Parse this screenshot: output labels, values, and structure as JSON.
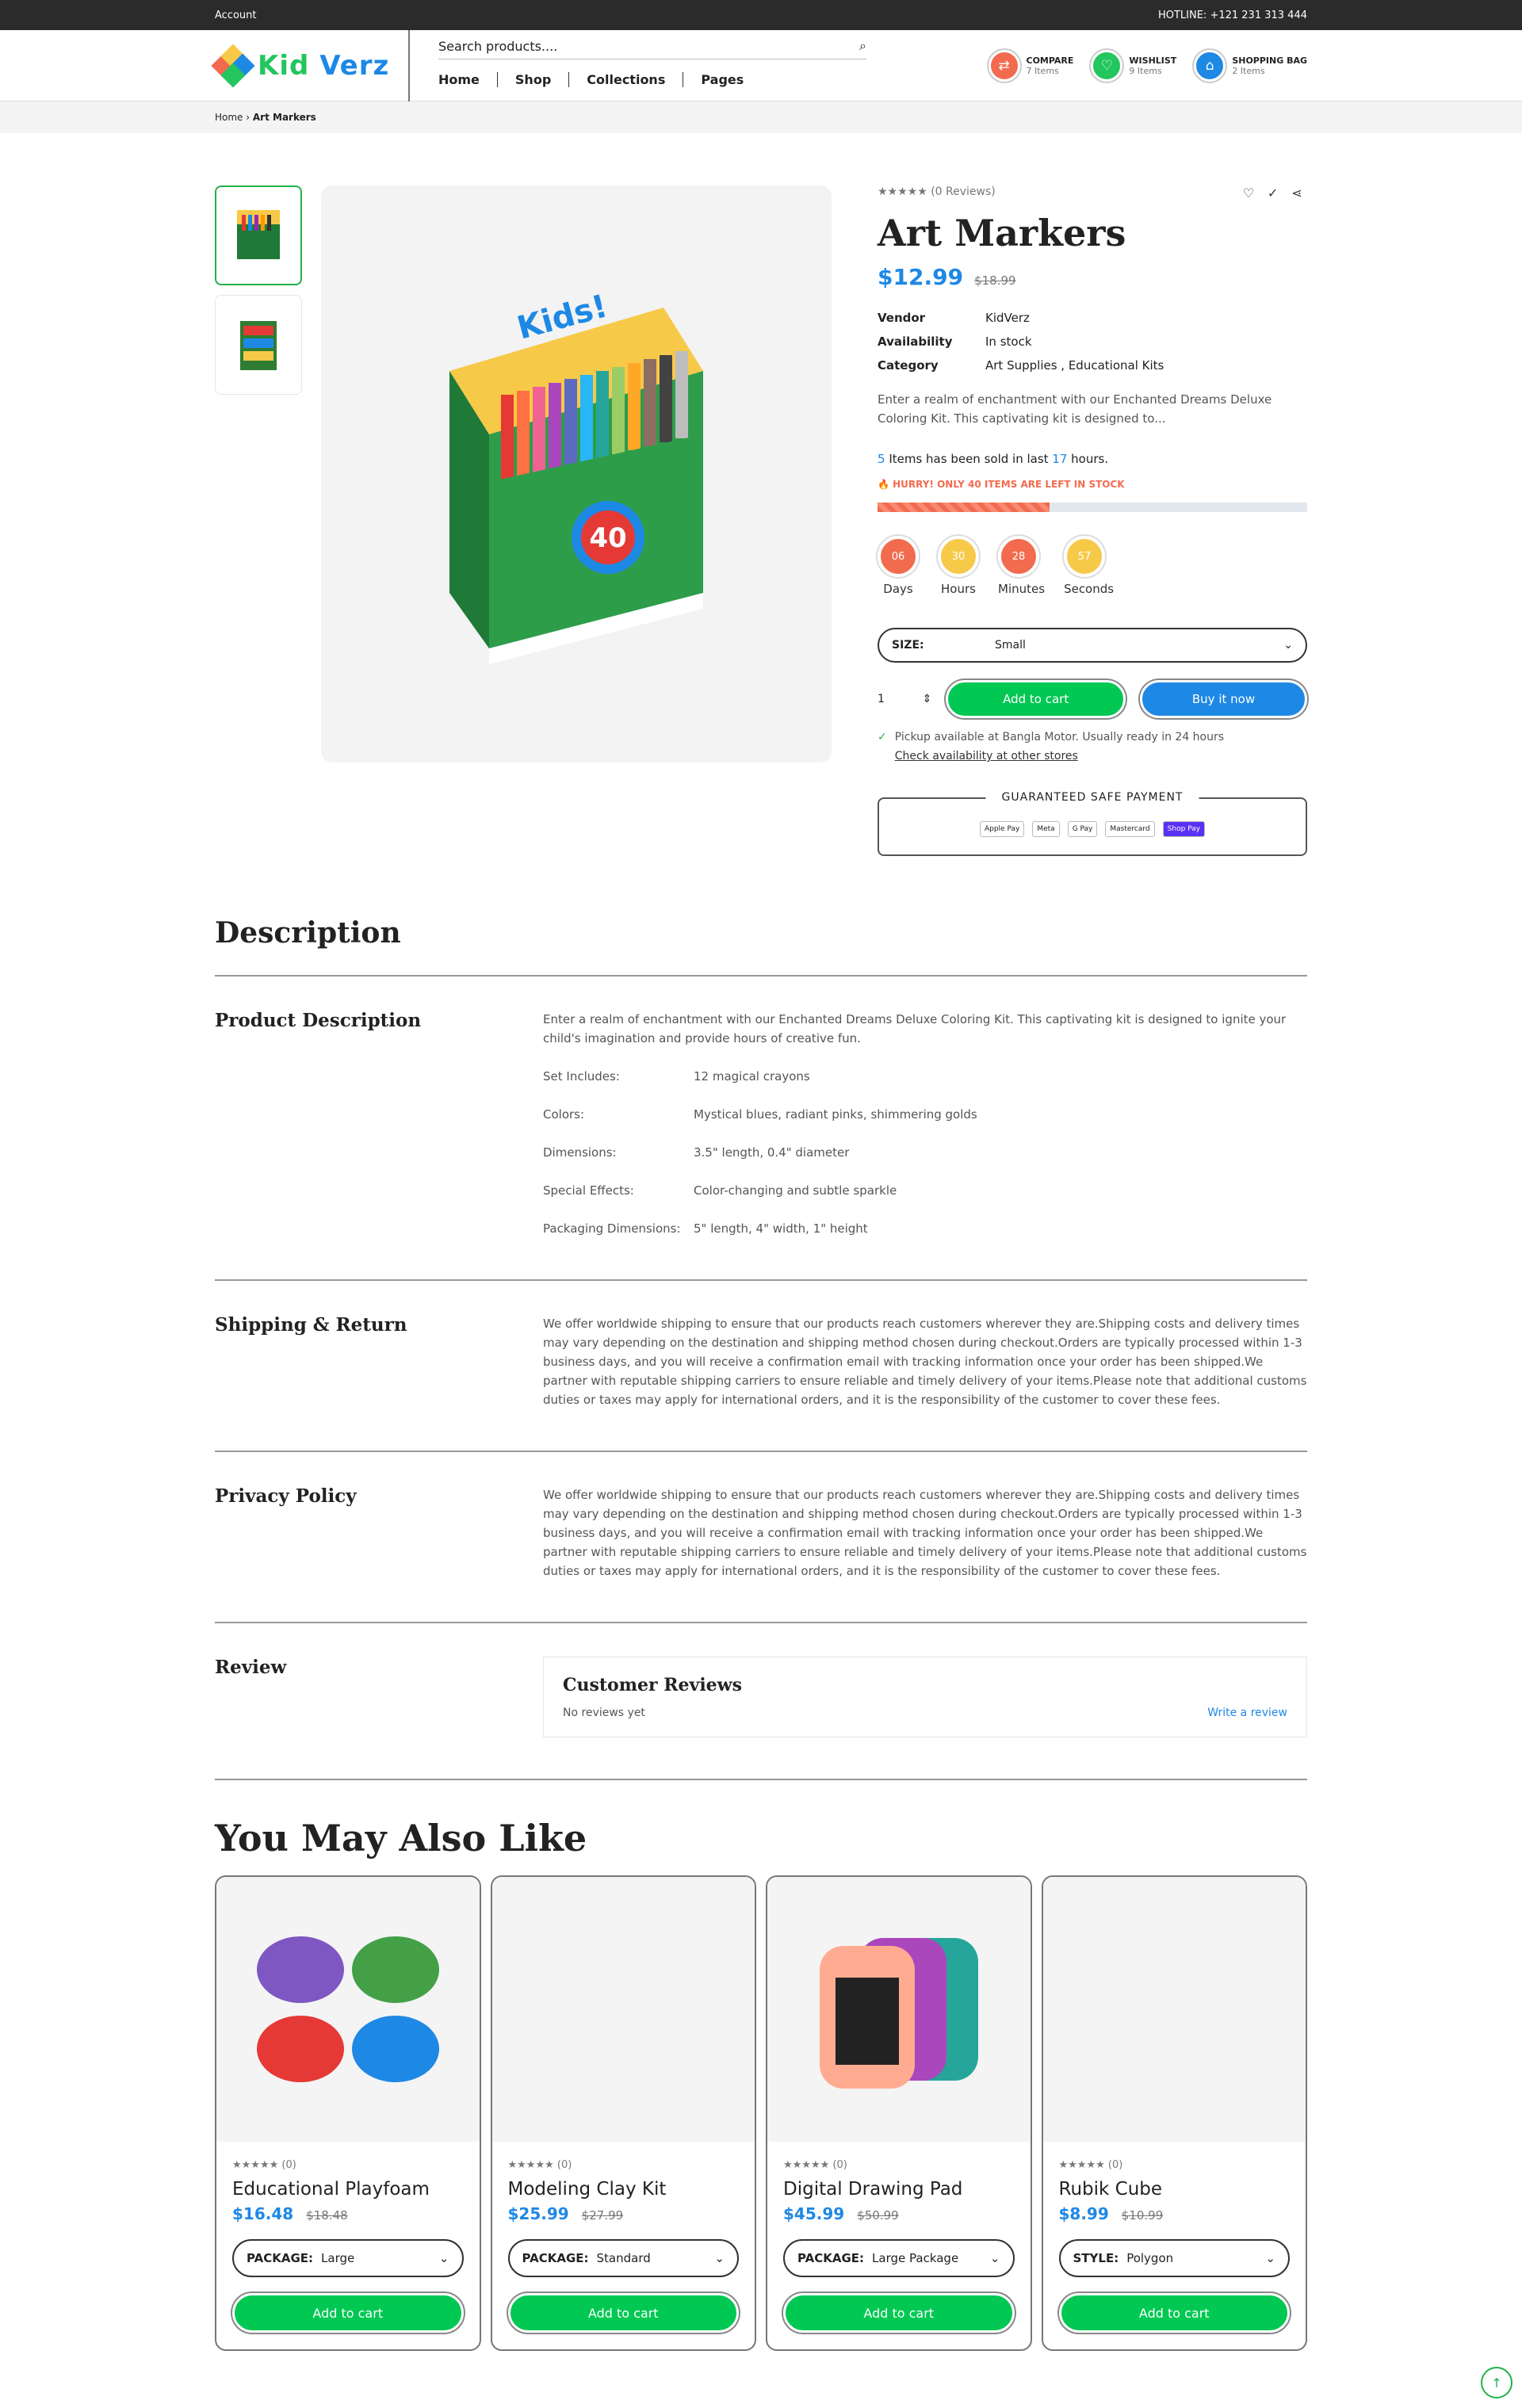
{
  "topbar": {
    "account": "Account",
    "hotline": "HOTLINE: +121 231 313 444"
  },
  "logo": {
    "text_kid": "Kid",
    "text_verz": "Verz"
  },
  "search": {
    "placeholder": "Search products...."
  },
  "menu": [
    "Home",
    "Shop",
    "Collections",
    "Pages"
  ],
  "header_icons": [
    {
      "label": "COMPARE",
      "count": "7 Items",
      "color": "#f26b4f",
      "icon": "compare-icon"
    },
    {
      "label": "WISHLIST",
      "count": "9 Items",
      "color": "#22c55e",
      "icon": "heart-icon"
    },
    {
      "label": "SHOPPING BAG",
      "count": "2 Items",
      "color": "#1e88e5",
      "icon": "bag-icon"
    }
  ],
  "breadcrumb": {
    "home": "Home",
    "current": "Art Markers"
  },
  "product": {
    "reviews": "★★★★★ (0 Reviews)",
    "title": "Art Markers",
    "price": "$12.99",
    "compare_price": "$18.99",
    "vendor_label": "Vendor",
    "vendor": "KidVerz",
    "availability_label": "Availability",
    "availability": "In stock",
    "category_label": "Category",
    "category": "Art Supplies ,  Educational Kits",
    "short_desc": "Enter a realm of enchantment with our Enchanted Dreams Deluxe Coloring Kit. This captivating kit is designed to...",
    "sold_count": "5",
    "sold_mid": " Items has been sold in last ",
    "sold_hours": "17",
    "sold_end": " hours.",
    "hurry": "HURRY! ONLY 40 ITEMS ARE LEFT IN STOCK",
    "stock_progress": 0.4,
    "timer": [
      {
        "value": "06",
        "label": "Days",
        "color": "#f26b4f"
      },
      {
        "value": "30",
        "label": "Hours",
        "color": "#f7c948"
      },
      {
        "value": "28",
        "label": "Minutes",
        "color": "#f26b4f"
      },
      {
        "value": "57",
        "label": "Seconds",
        "color": "#f7c948"
      }
    ],
    "size_label": "SIZE:",
    "size_value": "Small",
    "qty": "1",
    "add_to_cart": "Add to cart",
    "buy_now": "Buy it now",
    "pickup": "Pickup available at Bangla Motor. Usually ready in 24 hours",
    "check_availability": "Check availability at other stores",
    "safe_payment": "GUARANTEED SAFE PAYMENT",
    "payments": [
      "Apple Pay",
      "Meta",
      "G Pay",
      "Mastercard",
      "Shop Pay"
    ]
  },
  "description": {
    "title": "Description",
    "product_desc_title": "Product Description",
    "product_desc": "Enter a realm of enchantment with our Enchanted Dreams Deluxe Coloring Kit. This captivating kit is designed to ignite your child's imagination and provide hours of creative fun.",
    "specs": [
      {
        "k": "Set Includes:",
        "v": "12 magical crayons"
      },
      {
        "k": "Colors:",
        "v": "Mystical blues, radiant pinks, shimmering golds"
      },
      {
        "k": "Dimensions:",
        "v": "3.5\" length, 0.4\" diameter"
      },
      {
        "k": "Special Effects:",
        "v": "Color-changing and subtle sparkle"
      },
      {
        "k": "Packaging Dimensions:",
        "v": "5\" length, 4\" width, 1\" height"
      }
    ],
    "shipping_title": "Shipping & Return",
    "shipping_text": "We offer worldwide shipping to ensure that our products reach customers wherever they are.Shipping costs and delivery times may vary depending on the destination and shipping method chosen during checkout.Orders are typically processed within 1-3 business days, and you will receive a confirmation email with tracking information once your order has been shipped.We partner with reputable shipping carriers to ensure reliable and timely delivery of your items.Please note that additional customs duties or taxes may apply for international orders, and it is the responsibility of the customer to cover these fees.",
    "privacy_title": "Privacy Policy",
    "privacy_text": "We offer worldwide shipping to ensure that our products reach customers wherever they are.Shipping costs and delivery times may vary depending on the destination and shipping method chosen during checkout.Orders are typically processed within 1-3 business days, and you will receive a confirmation email with tracking information once your order has been shipped.We partner with reputable shipping carriers to ensure reliable and timely delivery of your items.Please note that additional customs duties or taxes may apply for international orders, and it is the responsibility of the customer to cover these fees.",
    "review_title": "Review",
    "customer_reviews": "Customer Reviews",
    "no_reviews": "No reviews yet",
    "write_review": "Write a review"
  },
  "also_like": {
    "title": "You May Also Like",
    "items": [
      {
        "stars": "★★★★★ (0)",
        "name": "Educational Playfoam",
        "price": "$16.48",
        "compare": "$18.48",
        "opt_label": "PACKAGE:",
        "opt_value": "Large",
        "btn": "Add to cart"
      },
      {
        "stars": "★★★★★ (0)",
        "name": "Modeling Clay Kit",
        "price": "$25.99",
        "compare": "$27.99",
        "opt_label": "PACKAGE:",
        "opt_value": "Standard",
        "btn": "Add to cart"
      },
      {
        "stars": "★★★★★ (0)",
        "name": "Digital Drawing Pad",
        "price": "$45.99",
        "compare": "$50.99",
        "opt_label": "PACKAGE:",
        "opt_value": "Large Package",
        "btn": "Add to cart"
      },
      {
        "stars": "★★★★★ (0)",
        "name": "Rubik Cube",
        "price": "$8.99",
        "compare": "$10.99",
        "opt_label": "STYLE:",
        "opt_value": "Polygon",
        "btn": "Add to cart"
      }
    ]
  }
}
